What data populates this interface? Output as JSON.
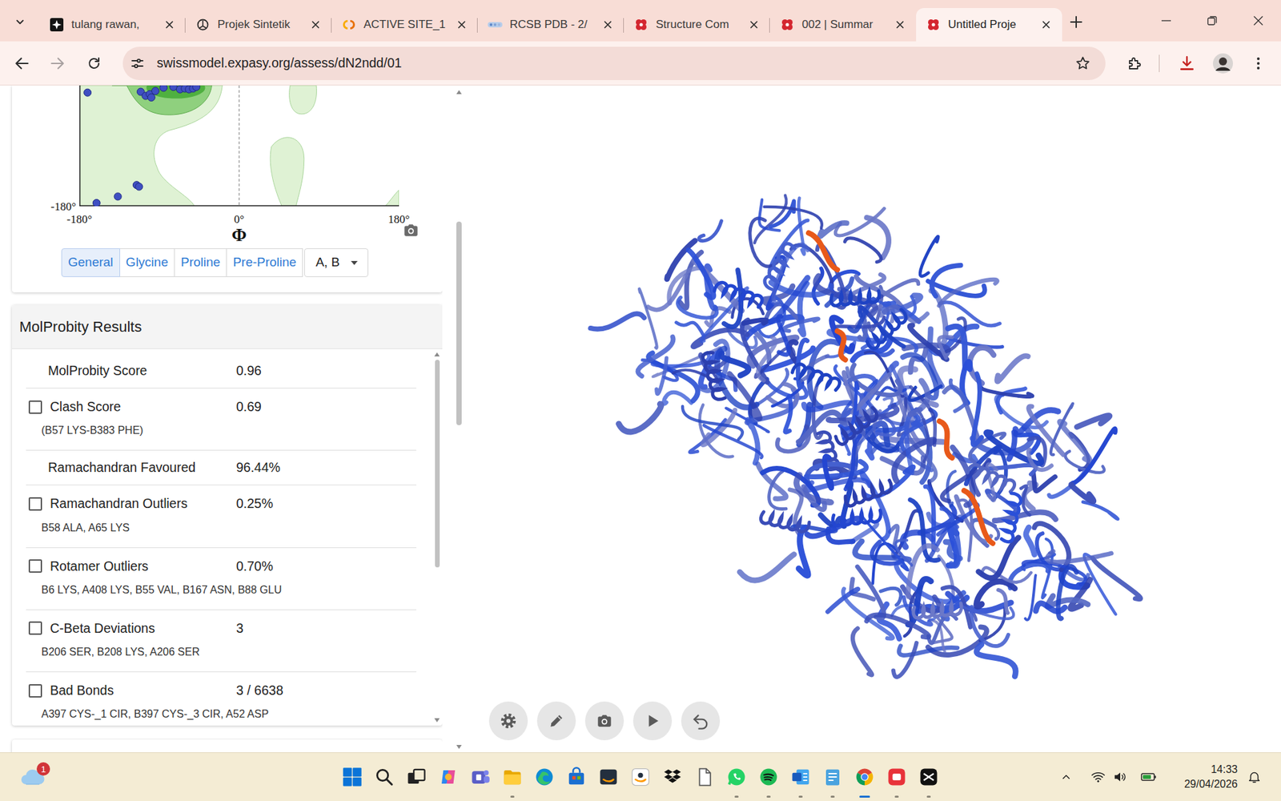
{
  "browser": {
    "tabs": [
      {
        "label": "tulang rawan,",
        "selected": false
      },
      {
        "label": "Projek Sintetik",
        "selected": false
      },
      {
        "label": "ACTIVE SITE_1",
        "selected": false
      },
      {
        "label": "RCSB PDB - 2/",
        "selected": false
      },
      {
        "label": "Structure Com",
        "selected": false
      },
      {
        "label": "002 | Summar",
        "selected": false
      },
      {
        "label": "Untitled Proje",
        "selected": true
      }
    ],
    "forward_disabled": true,
    "url": "swissmodel.expasy.org/assess/dN2ndd/01",
    "download_highlighted": true
  },
  "ramachandran": {
    "y_tick": "-180°",
    "x_ticks": [
      "-180°",
      "0°",
      "180°"
    ],
    "x_label": "Φ",
    "points": [
      [
        -170.8,
        -52.0
      ],
      [
        -110.9,
        -51.1
      ],
      [
        -105.4,
        -55.7
      ],
      [
        -100.8,
        -53.8
      ],
      [
        -99.0,
        -57.5
      ],
      [
        -94.4,
        -50.2
      ],
      [
        -85.2,
        -46.5
      ],
      [
        -74.1,
        -45.6
      ],
      [
        -66.7,
        -48.3
      ],
      [
        -61.2,
        -47.4
      ],
      [
        -56.6,
        -48.3
      ],
      [
        -52.0,
        -47.4
      ],
      [
        -48.3,
        -45.6
      ],
      [
        -115.5,
        -156.1
      ],
      [
        -112.8,
        -157.9
      ],
      [
        -136.7,
        -169.0
      ],
      [
        -160.7,
        -176.3
      ]
    ],
    "views": [
      {
        "label": "General",
        "selected": true
      },
      {
        "label": "Glycine",
        "selected": false
      },
      {
        "label": "Proline",
        "selected": false
      },
      {
        "label": "Pre-Proline",
        "selected": false
      }
    ],
    "chains": "A, B"
  },
  "molprobity": {
    "title": "MolProbity Results",
    "rows": [
      {
        "kind": "plain",
        "label": "MolProbity Score",
        "value": "0.96"
      },
      {
        "kind": "checkbox",
        "label": "Clash Score",
        "value": "0.69",
        "detail": "(B57 LYS-B383 PHE)",
        "checked": false
      },
      {
        "kind": "plain",
        "label": "Ramachandran Favoured",
        "value": "96.44%"
      },
      {
        "kind": "checkbox",
        "label": "Ramachandran Outliers",
        "value": "0.25%",
        "detail": "B58 ALA, A65 LYS",
        "checked": false
      },
      {
        "kind": "checkbox",
        "label": "Rotamer Outliers",
        "value": "0.70%",
        "detail": "B6 LYS, A408 LYS, B55 VAL, B167 ASN, B88 GLU",
        "checked": false
      },
      {
        "kind": "checkbox",
        "label": "C-Beta Deviations",
        "value": "3",
        "detail": "B206 SER, B208 LYS, A206 SER",
        "checked": false
      },
      {
        "kind": "checkbox",
        "label": "Bad Bonds",
        "value": "3 / 6638",
        "detail": "A397 CYS-_1 CIR, B397 CYS-_3 CIR, A52 ASP",
        "checked": false
      }
    ]
  },
  "taskbar": {
    "notifications": "1",
    "apps": [
      {
        "running": false,
        "active": false
      },
      {
        "running": false,
        "active": false
      },
      {
        "running": false,
        "active": false
      },
      {
        "running": false,
        "active": false
      },
      {
        "running": false,
        "active": false
      },
      {
        "running": true,
        "active": false
      },
      {
        "running": false,
        "active": false
      },
      {
        "running": false,
        "active": false
      },
      {
        "running": false,
        "active": false
      },
      {
        "running": false,
        "active": false
      },
      {
        "running": false,
        "active": false
      },
      {
        "running": false,
        "active": false
      },
      {
        "running": true,
        "active": false
      },
      {
        "running": true,
        "active": false
      },
      {
        "running": true,
        "active": false
      },
      {
        "running": true,
        "active": false
      },
      {
        "running": true,
        "active": true
      },
      {
        "running": true,
        "active": false
      },
      {
        "running": true,
        "active": false
      }
    ],
    "time": "14:33",
    "date": "29/04/2026"
  }
}
